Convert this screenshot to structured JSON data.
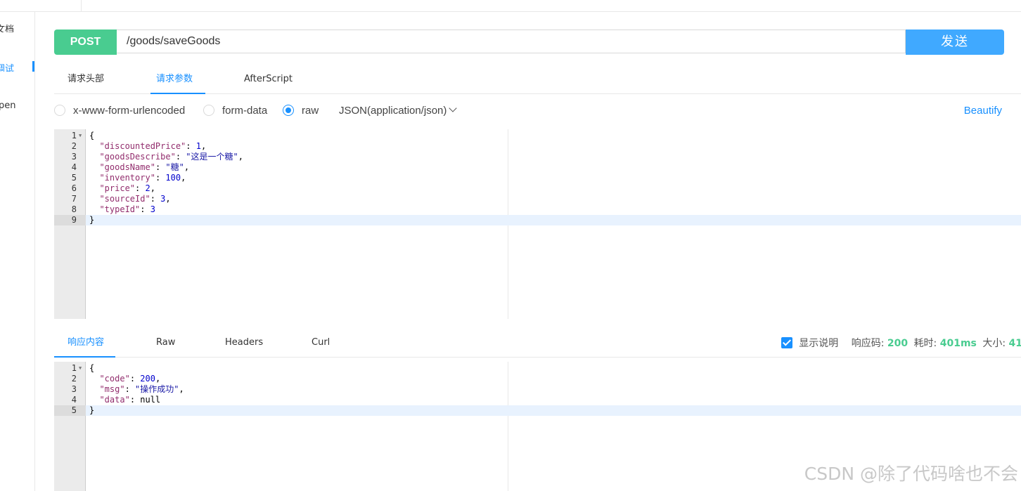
{
  "sidebar": {
    "items": [
      {
        "label": "文档"
      },
      {
        "label": "调试"
      },
      {
        "label": "pen"
      }
    ]
  },
  "request": {
    "method": "POST",
    "url": "/goods/saveGoods",
    "send_label": "发送"
  },
  "request_tabs": [
    {
      "label": "请求头部"
    },
    {
      "label": "请求参数"
    },
    {
      "label": "AfterScript"
    }
  ],
  "body_types": [
    {
      "label": "x-www-form-urlencoded",
      "checked": false
    },
    {
      "label": "form-data",
      "checked": false
    },
    {
      "label": "raw",
      "checked": true
    }
  ],
  "content_type": "JSON(application/json)",
  "beautify_label": "Beautify",
  "request_body": [
    {
      "no": "1",
      "text": "{"
    },
    {
      "no": "2",
      "text": "  \"discountedPrice\": 1,"
    },
    {
      "no": "3",
      "text": "  \"goodsDescribe\": \"这是一个糖\","
    },
    {
      "no": "4",
      "text": "  \"goodsName\": \"糖\","
    },
    {
      "no": "5",
      "text": "  \"inventory\": 100,"
    },
    {
      "no": "6",
      "text": "  \"price\": 2,"
    },
    {
      "no": "7",
      "text": "  \"sourceId\": 3,"
    },
    {
      "no": "8",
      "text": "  \"typeId\": 3"
    },
    {
      "no": "9",
      "text": "}"
    }
  ],
  "response_tabs": [
    {
      "label": "响应内容"
    },
    {
      "label": "Raw"
    },
    {
      "label": "Headers"
    },
    {
      "label": "Curl"
    }
  ],
  "response_meta": {
    "show_desc_label": "显示说明",
    "show_desc_checked": true,
    "status_label": "响应码:",
    "status_value": "200",
    "time_label": "耗时:",
    "time_value": "401ms",
    "size_label": "大小:",
    "size_value": "41"
  },
  "response_body": [
    {
      "no": "1",
      "text": "{"
    },
    {
      "no": "2",
      "text": "  \"code\": 200,"
    },
    {
      "no": "3",
      "text": "  \"msg\": \"操作成功\","
    },
    {
      "no": "4",
      "text": "  \"data\": null"
    },
    {
      "no": "5",
      "text": "}"
    }
  ],
  "watermark": "CSDN @除了代码啥也不会",
  "colors": {
    "method_bg": "#49cc90",
    "send_bg": "#40a9ff",
    "accent": "#1890ff"
  }
}
